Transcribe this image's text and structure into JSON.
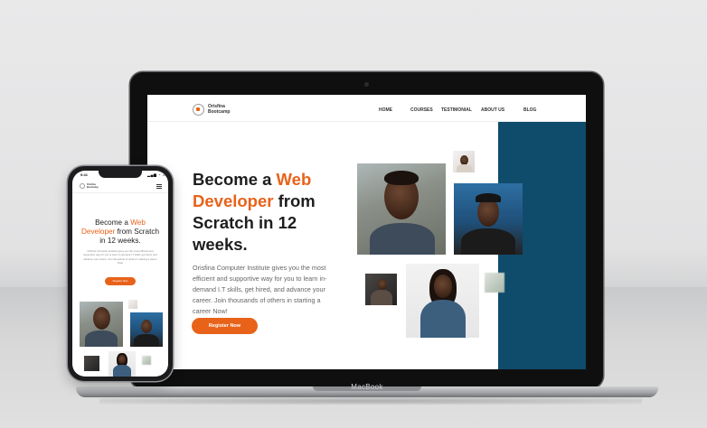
{
  "site": {
    "logo_line1": "Orisfina",
    "logo_line2": "Bootcamp",
    "nav": [
      "HOME",
      "COURSES",
      "TESTIMONIAL",
      "ABOUT US",
      "BLOG"
    ],
    "hero": {
      "title_part1": "Become a ",
      "title_accent": "Web Developer",
      "title_part2": " from Scratch in 12 weeks.",
      "body": "Orisfina Computer Institute gives you the most efficient and supportive way for you to learn in-demand I.T skills, get hired, and advance your career. Join thousands of others in starting a career Now!",
      "cta": "Register Now"
    },
    "accent_color": "#e8621a",
    "panel_color": "#0f4b6b"
  },
  "phone": {
    "time": "9:41",
    "status": "▂▄▆ ◔ ▭",
    "title_part1": "Become a ",
    "title_accent_word1": "Web",
    "title_accent_word2": "Developer",
    "title_part2": " from Scratch in 12 weeks.",
    "body": "Orisfina Computer Institute gives you the most efficient and supportive way for you to learn in-demand I.T skills, get hired, and advance your career. Join thousands of others in starting a career Now!",
    "cta": "Register Now"
  },
  "device": {
    "laptop_brand": "MacBook"
  },
  "icons": {
    "logo": "laurel-circle-icon",
    "menu": "hamburger-menu-icon"
  }
}
